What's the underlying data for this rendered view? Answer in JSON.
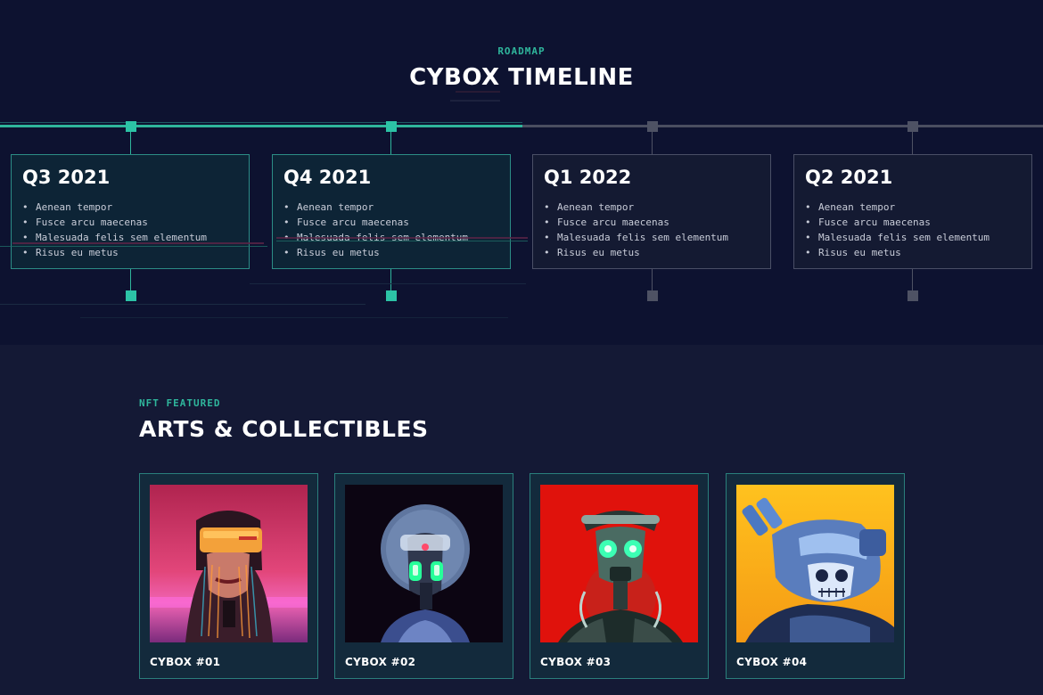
{
  "roadmap": {
    "eyebrow": "ROADMAP",
    "title": "CYBOX TIMELINE",
    "milestones": [
      {
        "quarter": "Q3 2021",
        "status": "active",
        "items": [
          "Aenean tempor",
          "Fusce arcu maecenas",
          "Malesuada felis sem elementum",
          "Risus eu metus"
        ]
      },
      {
        "quarter": "Q4 2021",
        "status": "active",
        "items": [
          "Aenean tempor",
          "Fusce arcu maecenas",
          "Malesuada felis sem elementum",
          "Risus eu metus"
        ]
      },
      {
        "quarter": "Q1 2022",
        "status": "inactive",
        "items": [
          "Aenean tempor",
          "Fusce arcu maecenas",
          "Malesuada felis sem elementum",
          "Risus eu metus"
        ]
      },
      {
        "quarter": "Q2 2021",
        "status": "inactive",
        "items": [
          "Aenean tempor",
          "Fusce arcu maecenas",
          "Malesuada felis sem elementum",
          "Risus eu metus"
        ]
      }
    ],
    "bullet": "•"
  },
  "nft": {
    "eyebrow": "NFT FEATURED",
    "title": "ARTS & COLLECTIBLES",
    "items": [
      {
        "name": "CYBOX #01",
        "art": "vr-headset-woman"
      },
      {
        "name": "CYBOX #02",
        "art": "astronaut-robot"
      },
      {
        "name": "CYBOX #03",
        "art": "green-eyed-robot"
      },
      {
        "name": "CYBOX #04",
        "art": "skull-robot"
      }
    ]
  },
  "colors": {
    "accent": "#2fb69c",
    "roadmap_bg": "#0d1230",
    "page_bg": "#141935",
    "inactive": "#4e5264"
  }
}
